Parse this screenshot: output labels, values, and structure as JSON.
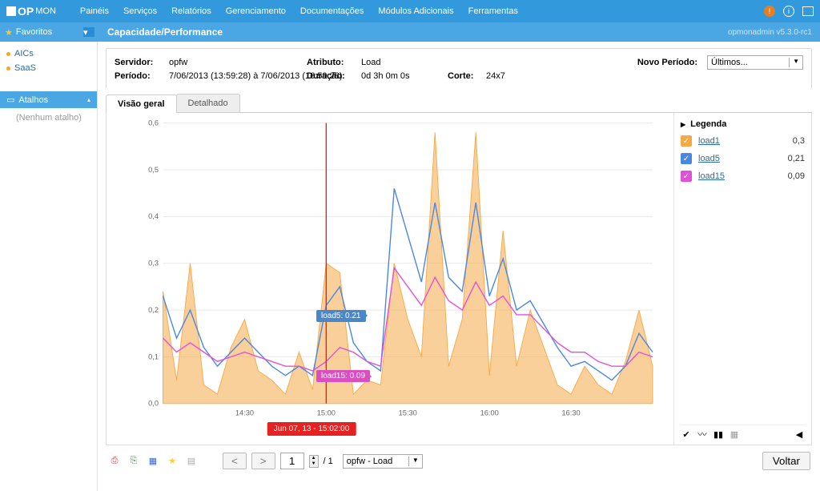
{
  "brand": {
    "op": "OP",
    "mon": "MON"
  },
  "topnav": [
    "Painéis",
    "Serviços",
    "Relatórios",
    "Gerenciamento",
    "Documentações",
    "Módulos Adicionais",
    "Ferramentas"
  ],
  "favorites_label": "Favoritos",
  "breadcrumb": "Capacidade/Performance",
  "version": "opmonadmin   v5.3.0-rc1",
  "sidebar": {
    "tree": [
      "AICs",
      "SaaS"
    ],
    "shortcuts_header": "Atalhos",
    "shortcuts_empty": "(Nenhum atalho)"
  },
  "meta": {
    "servidor_lbl": "Servidor:",
    "servidor_val": "opfw",
    "atributo_lbl": "Atributo:",
    "atributo_val": "Load",
    "periodo_lbl": "Período:",
    "periodo_val": "7/06/2013 (13:59:28) à 7/06/2013 (16:59:28)",
    "duracao_lbl": "Duração:",
    "duracao_val": "0d 3h 0m 0s",
    "corte_lbl": "Corte:",
    "corte_val": "24x7",
    "novo_lbl": "Novo Período:",
    "novo_val": "Últimos..."
  },
  "tabs": {
    "overview": "Visão geral",
    "detail": "Detalhado"
  },
  "legend": {
    "title": "Legenda",
    "items": [
      {
        "name": "load1",
        "val": "0,3",
        "color": "#f5a947"
      },
      {
        "name": "load5",
        "val": "0,21",
        "color": "#4a87e0"
      },
      {
        "name": "load15",
        "val": "0,09",
        "color": "#e250d7"
      }
    ]
  },
  "annotations": {
    "load5": "load5: 0.21",
    "load15": "load15: 0.09",
    "time": "Jun 07, 13 - 15:02:00"
  },
  "footer": {
    "page": "1",
    "total": "/ 1",
    "selector": "opfw - Load",
    "back": "Voltar"
  },
  "chart_data": {
    "type": "line",
    "title": "",
    "xlabel": "",
    "ylabel": "",
    "ylim": [
      0,
      0.6
    ],
    "x_ticks": [
      "14:30",
      "15:00",
      "15:30",
      "16:00",
      "16:30"
    ],
    "y_ticks": [
      "0,0",
      "0,1",
      "0,2",
      "0,3",
      "0,4",
      "0,5",
      "0,6"
    ],
    "x_count": 37,
    "cursor_index": 12,
    "series": [
      {
        "name": "load1",
        "color": "#f5a947",
        "fill": true,
        "values": [
          0.24,
          0.05,
          0.3,
          0.04,
          0.02,
          0.12,
          0.18,
          0.07,
          0.05,
          0.02,
          0.11,
          0.03,
          0.3,
          0.28,
          0.02,
          0.05,
          0.04,
          0.3,
          0.18,
          0.1,
          0.58,
          0.08,
          0.18,
          0.58,
          0.06,
          0.37,
          0.08,
          0.2,
          0.12,
          0.04,
          0.02,
          0.08,
          0.04,
          0.02,
          0.09,
          0.2,
          0.08
        ]
      },
      {
        "name": "load5",
        "color": "#4a87e0",
        "fill": false,
        "values": [
          0.23,
          0.14,
          0.2,
          0.12,
          0.08,
          0.11,
          0.14,
          0.11,
          0.08,
          0.06,
          0.08,
          0.06,
          0.21,
          0.25,
          0.13,
          0.09,
          0.07,
          0.46,
          0.36,
          0.26,
          0.43,
          0.27,
          0.24,
          0.43,
          0.23,
          0.31,
          0.2,
          0.22,
          0.17,
          0.12,
          0.08,
          0.09,
          0.07,
          0.05,
          0.08,
          0.15,
          0.11
        ]
      },
      {
        "name": "load15",
        "color": "#e250d7",
        "fill": false,
        "values": [
          0.14,
          0.11,
          0.13,
          0.11,
          0.09,
          0.1,
          0.11,
          0.1,
          0.09,
          0.08,
          0.08,
          0.07,
          0.09,
          0.12,
          0.11,
          0.09,
          0.08,
          0.29,
          0.25,
          0.21,
          0.27,
          0.22,
          0.2,
          0.26,
          0.21,
          0.23,
          0.19,
          0.19,
          0.16,
          0.13,
          0.11,
          0.11,
          0.09,
          0.08,
          0.08,
          0.11,
          0.1
        ]
      }
    ]
  }
}
